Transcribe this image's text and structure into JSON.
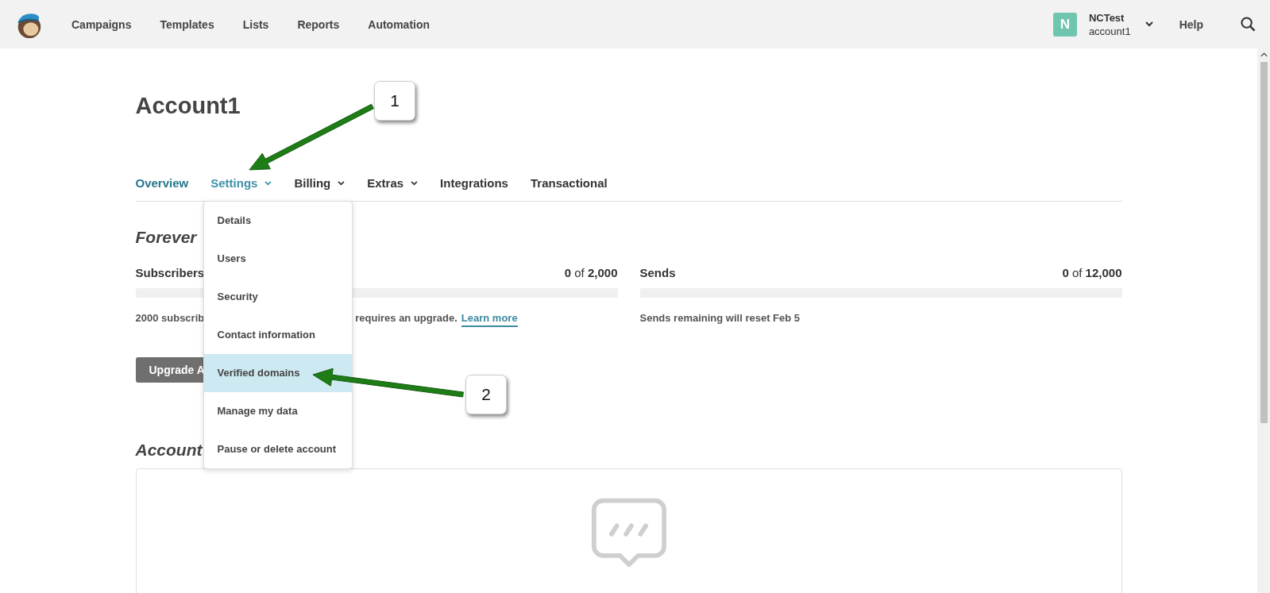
{
  "top_nav": {
    "items": [
      {
        "label": "Campaigns"
      },
      {
        "label": "Templates"
      },
      {
        "label": "Lists"
      },
      {
        "label": "Reports"
      },
      {
        "label": "Automation"
      }
    ],
    "account": {
      "avatar": "N",
      "name": "NCTest",
      "sub": "account1"
    },
    "help": "Help"
  },
  "page": {
    "title": "Account1"
  },
  "tabs": [
    {
      "label": "Overview",
      "selected": true,
      "has_menu": false,
      "expanded": false
    },
    {
      "label": "Settings",
      "selected": false,
      "has_menu": true,
      "expanded": true
    },
    {
      "label": "Billing",
      "selected": false,
      "has_menu": true,
      "expanded": false
    },
    {
      "label": "Extras",
      "selected": false,
      "has_menu": true,
      "expanded": false
    },
    {
      "label": "Integrations",
      "selected": false,
      "has_menu": false,
      "expanded": false
    },
    {
      "label": "Transactional",
      "selected": false,
      "has_menu": false,
      "expanded": false
    }
  ],
  "settings_menu": [
    {
      "label": "Details",
      "selected": false
    },
    {
      "label": "Users",
      "selected": false
    },
    {
      "label": "Security",
      "selected": false
    },
    {
      "label": "Contact information",
      "selected": false
    },
    {
      "label": "Verified domains",
      "selected": true
    },
    {
      "label": "Manage my data",
      "selected": false
    },
    {
      "label": "Pause or delete account",
      "selected": false
    }
  ],
  "plan": {
    "heading": "Forever",
    "meters": [
      {
        "label": "Subscribers",
        "reading": "**0** of **2,000**",
        "level": 0,
        "notes": [
          "2000 subscrib",
          "requires an upgrade."
        ],
        "link": "Learn more"
      },
      {
        "label": "Sends",
        "reading": "**0** of **12,000**",
        "level": 0,
        "notes": [
          "Sends remaining will reset Feb 5"
        ]
      }
    ],
    "button": "Upgrade A"
  },
  "account_info": {
    "heading": "Account"
  },
  "annotations": [
    {
      "number": "1"
    },
    {
      "number": "2"
    }
  ]
}
